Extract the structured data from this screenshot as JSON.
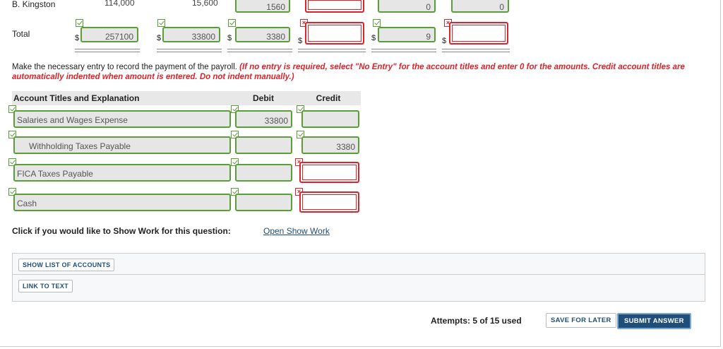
{
  "top_row": {
    "label": "B. Kingston",
    "v1": "114,000",
    "v2": "15,600",
    "v3": "1560",
    "v6": "0",
    "v7": "0"
  },
  "total_row": {
    "label": "Total",
    "currency": "$",
    "v1": "257100",
    "v2": "33800",
    "v3": "3380",
    "v6": "9"
  },
  "instruction": {
    "main": "Make the necessary entry to record the payment of the payroll. ",
    "note": "(If no entry is required, select \"No Entry\" for the account titles and enter 0 for the amounts. Credit account titles are automatically indented when amount is entered. Do not indent manually.)"
  },
  "journal": {
    "headers": {
      "account": "Account Titles and Explanation",
      "debit": "Debit",
      "credit": "Credit"
    },
    "rows": [
      {
        "account": "Salaries and Wages Expense",
        "debit": "33800",
        "credit": ""
      },
      {
        "account": "Withholding Taxes Payable",
        "debit": "",
        "credit": "3380"
      },
      {
        "account": "FICA Taxes Payable",
        "debit": "",
        "credit": ""
      },
      {
        "account": "Cash",
        "debit": "",
        "credit": ""
      }
    ]
  },
  "show_work": {
    "prompt": "Click if you would like to Show Work for this question:",
    "link": "Open Show Work"
  },
  "panels": {
    "accounts_btn": "SHOW LIST OF ACCOUNTS",
    "text_btn": "LINK TO TEXT"
  },
  "footer": {
    "attempts": "Attempts: 5 of 15 used",
    "save": "SAVE FOR LATER",
    "submit": "SUBMIT ANSWER"
  },
  "colors": {
    "correct": "#5a9e3a",
    "incorrect": "#d9252b",
    "link": "#1f4e79",
    "submit_bg": "#1f4e79"
  }
}
